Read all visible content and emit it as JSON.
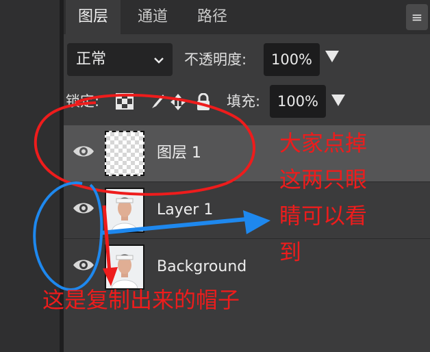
{
  "tabs": [
    {
      "label": "图层",
      "active": true
    },
    {
      "label": "通道",
      "active": false
    },
    {
      "label": "路径",
      "active": false
    }
  ],
  "panel_menu_icon": "hamburger-menu-icon",
  "blend_mode": {
    "value": "正常"
  },
  "opacity": {
    "label": "不透明度:",
    "value": "100%"
  },
  "lock": {
    "label": "锁定:",
    "icons": [
      "lock-transparent-pixels-icon",
      "lock-image-pixels-icon",
      "lock-position-icon",
      "lock-all-icon"
    ]
  },
  "fill": {
    "label": "填充:",
    "value": "100%"
  },
  "layers": [
    {
      "name": "图层 1",
      "visible": true,
      "selected": true,
      "thumbnail": "transparent"
    },
    {
      "name": "Layer 1",
      "visible": true,
      "selected": false,
      "thumbnail": "portrait-photo"
    },
    {
      "name": "Background",
      "visible": true,
      "selected": false,
      "thumbnail": "portrait-photo"
    }
  ],
  "annotations": {
    "note_right": [
      "大家点掉",
      "这两只眼",
      "睛可以看",
      "到"
    ],
    "note_bottom": "这是复制出来的帽子",
    "color": "#ee1c1c",
    "circle_color": "#1e88ee"
  },
  "colors": {
    "panel_bg": "#3b3b3c",
    "selected_row": "#555556",
    "input_bg": "#1c1c1d"
  }
}
